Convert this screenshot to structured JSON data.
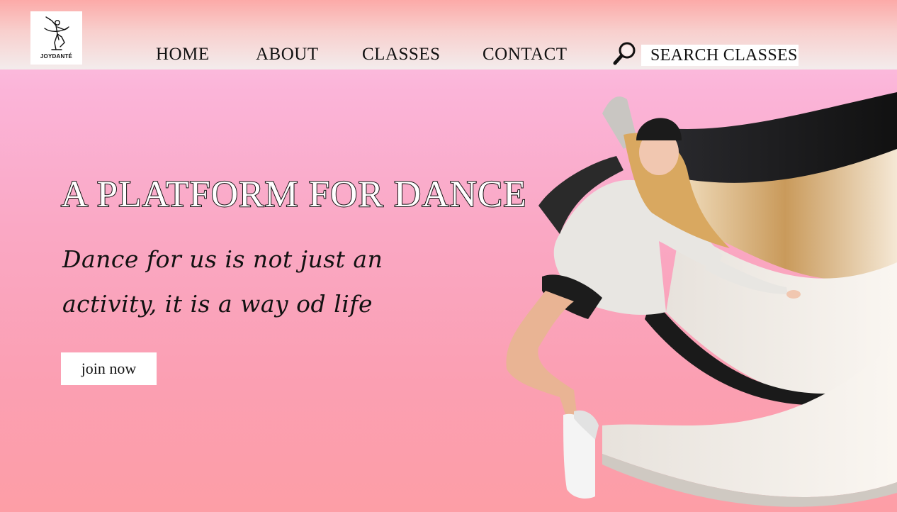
{
  "brand": {
    "logo_text": "JOYDANTÉ"
  },
  "nav": {
    "items": [
      {
        "label": "HOME"
      },
      {
        "label": "ABOUT"
      },
      {
        "label": "CLASSES"
      },
      {
        "label": "CONTACT"
      }
    ]
  },
  "search": {
    "value": "SEARCH CLASSES"
  },
  "hero": {
    "title": "A PLATFORM FOR DANCE",
    "tagline_line1": "Dance for us is not just an",
    "tagline_line2": "activity, it is a way od life",
    "cta_label": "join now"
  },
  "colors": {
    "background_top": "#fcc6e6",
    "background_bottom": "#fd9ea6",
    "header_top": "#fcaaa8",
    "header_bottom": "#f3ecec",
    "text": "#111111",
    "button_bg": "#ffffff"
  },
  "icons": {
    "search": "magnifier-icon",
    "logo": "dancer-logo-icon"
  }
}
